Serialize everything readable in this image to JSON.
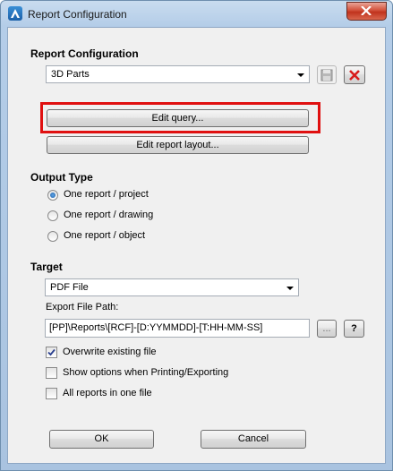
{
  "window": {
    "title": "Report Configuration"
  },
  "report_config": {
    "heading": "Report Configuration",
    "selected": "3D Parts",
    "edit_query_label": "Edit query...",
    "edit_layout_label": "Edit report layout..."
  },
  "output_type": {
    "heading": "Output Type",
    "options": [
      {
        "label": "One report / project",
        "selected": true
      },
      {
        "label": "One report / drawing",
        "selected": false
      },
      {
        "label": "One report / object",
        "selected": false
      }
    ]
  },
  "target": {
    "heading": "Target",
    "selected": "PDF File",
    "export_path_label": "Export File Path:",
    "export_path_value": "[PP]\\Reports\\[RCF]-[D:YYMMDD]-[T:HH-MM-SS]",
    "browse_label": "...",
    "help_label": "?",
    "checkboxes": [
      {
        "label": "Overwrite existing file",
        "checked": true
      },
      {
        "label": "Show options when Printing/Exporting",
        "checked": false
      },
      {
        "label": "All reports in one file",
        "checked": false
      }
    ]
  },
  "buttons": {
    "ok": "OK",
    "cancel": "Cancel"
  },
  "colors": {
    "highlight": "#e01010",
    "close": "#c0331d"
  }
}
